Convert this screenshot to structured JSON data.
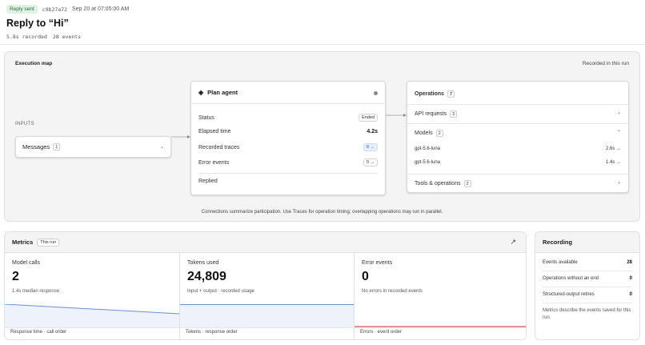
{
  "header": {
    "status_badge": "Reply sent",
    "run_id": "c9b27a72",
    "timestamp": "Sep 20 at 07:05:00 AM",
    "title": "Reply to “Hi”",
    "duration": "5.8s recorded",
    "events": "28 events"
  },
  "execution_map": {
    "title": "Execution map",
    "recorded_label": "Recorded in this run",
    "inputs_label": "INPUTS",
    "messages": {
      "label": "Messages",
      "count": "1"
    },
    "plan_agent": {
      "title": "Plan agent",
      "status_label": "Status",
      "status_value": "Ended",
      "elapsed_label": "Elapsed time",
      "elapsed_value": "4.2s",
      "traces_label": "Recorded traces",
      "traces_value": "8 →",
      "errors_label": "Error events",
      "errors_value": "0 →",
      "result": "Replied"
    },
    "operations": {
      "title": "Operations",
      "count": "7",
      "api_label": "API requests",
      "api_count": "3",
      "models_label": "Models",
      "models_count": "2",
      "models": [
        {
          "name": "gpt-5.6-luna",
          "time": "2.6s →"
        },
        {
          "name": "gpt-5.6-luna",
          "time": "1.4s →"
        }
      ],
      "tools_label": "Tools & operations",
      "tools_count": "2"
    },
    "footnote": "Connections summarize participation. Use Traces for operation timing; overlapping operations may run in parallel."
  },
  "metrics": {
    "title": "Metrics",
    "tag": "This run",
    "cards": [
      {
        "label": "Model calls",
        "value": "2",
        "sub": "1.4s median response",
        "foot": "Response time · call order",
        "series": [
          2.6,
          1.4
        ]
      },
      {
        "label": "Tokens used",
        "value": "24,809",
        "sub": "Input + output · recorded usage",
        "foot": "Tokens · response order"
      },
      {
        "label": "Error events",
        "value": "0",
        "sub": "No errors in recorded events",
        "foot": "Errors · event order"
      }
    ]
  },
  "recording": {
    "title": "Recording",
    "rows": [
      {
        "label": "Events available",
        "value": "28"
      },
      {
        "label": "Operations without an end",
        "value": "0"
      },
      {
        "label": "Structured-output retries",
        "value": "0"
      }
    ],
    "note": "Metrics describe the events saved for this run."
  },
  "colors": {
    "accent_blue": "#6b8fd6",
    "fill_blue": "#eef2fb",
    "error_red": "#d9534f",
    "success_badge": "#dff2e3"
  },
  "icons": [
    "diamond-icon",
    "status-dot-icon",
    "chevron-down-icon",
    "chevron-up-icon",
    "external-link-icon",
    "arrow-right-icon"
  ]
}
